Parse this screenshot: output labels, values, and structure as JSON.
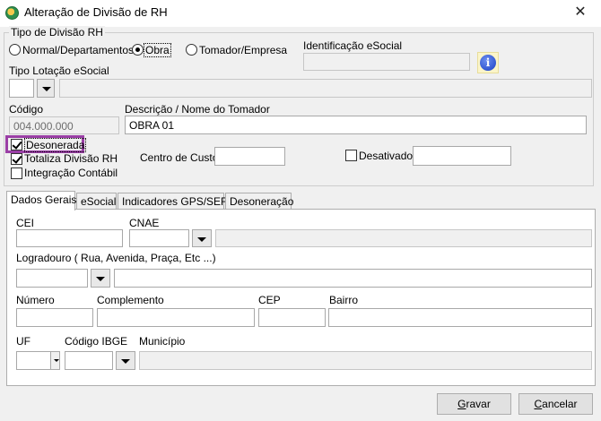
{
  "window": {
    "title": "Alteração de Divisão de RH",
    "close_glyph": "✕"
  },
  "tipo_divisao": {
    "group_title": "Tipo de Divisão RH",
    "options": [
      "Normal/Departamentos",
      "Obra",
      "Tomador/Empresa"
    ],
    "selected": "Obra"
  },
  "identificacao": {
    "label": "Identificação eSocial",
    "value": ""
  },
  "tipo_lotacao": {
    "label": "Tipo Lotação eSocial",
    "code": "",
    "description": ""
  },
  "codigo": {
    "label": "Código",
    "value": "004.000.000"
  },
  "descricao": {
    "label": "Descrição / Nome do Tomador",
    "value": "OBRA 01"
  },
  "checks": {
    "desonerada": {
      "label": "Desonerada",
      "checked": true
    },
    "totaliza": {
      "label": "Totaliza Divisão RH",
      "checked": true
    },
    "integracao": {
      "label": "Integração Contábil",
      "checked": false
    },
    "desativado": {
      "label": "Desativado",
      "checked": false
    }
  },
  "centro_custo": {
    "label": "Centro de Custo",
    "value": ""
  },
  "desativado_value": "",
  "tabs": [
    "Dados Gerais",
    "eSocial",
    "Indicadores GPS/SEFIP",
    "Desoneração"
  ],
  "active_tab": "Dados Gerais",
  "dados_gerais": {
    "cei_label": "CEI",
    "cnae_label": "CNAE",
    "logradouro_label": "Logradouro ( Rua, Avenida, Praça, Etc ...)",
    "numero_label": "Número",
    "complemento_label": "Complemento",
    "cep_label": "CEP",
    "bairro_label": "Bairro",
    "uf_label": "UF",
    "ibge_label": "Código IBGE",
    "municipio_label": "Município"
  },
  "buttons": {
    "gravar": {
      "label": "Gravar",
      "mnemonic": "G"
    },
    "cancelar": {
      "label": "Cancelar",
      "mnemonic": "C"
    }
  },
  "colors": {
    "highlight": "#9b3fa6",
    "info_icon": "#1a3fc4"
  },
  "icons": {
    "app": "app-logo-icon",
    "info": "info-icon",
    "close": "close-icon",
    "dropdown": "chevron-down-icon"
  }
}
